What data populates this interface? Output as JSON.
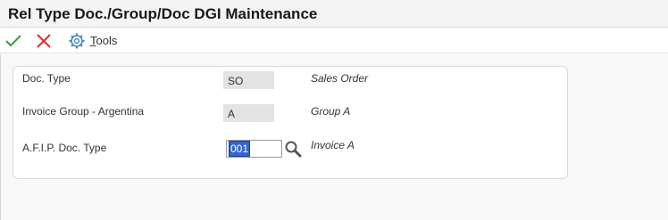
{
  "window": {
    "title": "Rel Type Doc./Group/Doc DGI Maintenance"
  },
  "toolbar": {
    "ok_icon": "checkmark-icon",
    "cancel_icon": "close-icon",
    "tools_icon": "gear-icon",
    "tools_label_underlined": "T",
    "tools_label_rest": "ools"
  },
  "form": {
    "doc_type": {
      "label": "Doc. Type",
      "value": "SO",
      "description": "Sales Order"
    },
    "invoice_group": {
      "label": "Invoice Group - Argentina",
      "value": "A",
      "description": "Group A"
    },
    "afip_doc_type": {
      "label": "A.F.I.P. Doc. Type",
      "value": "001",
      "description": "Invoice A",
      "search_icon": "search-icon"
    }
  },
  "colors": {
    "ok_green": "#3c9a3c",
    "cancel_red": "#d9342b",
    "tools_blue": "#4a86c5",
    "selection_blue": "#3366cc"
  }
}
